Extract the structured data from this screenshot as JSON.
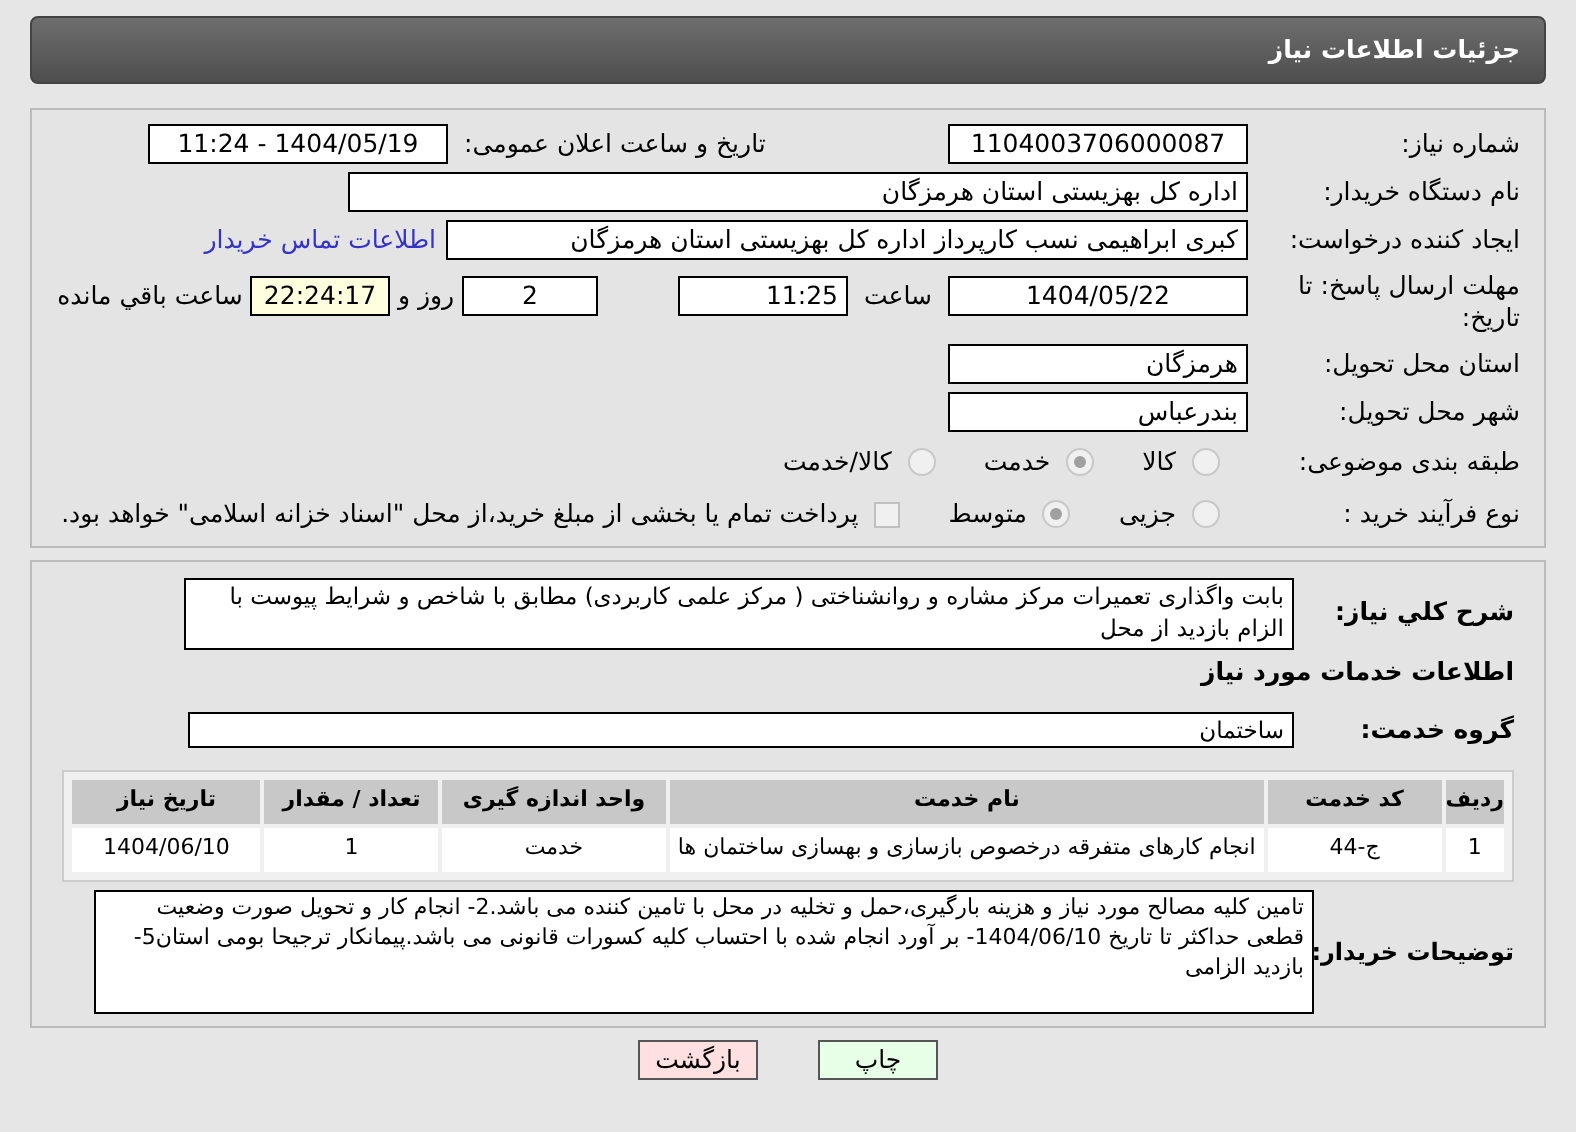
{
  "header": {
    "title": "جزئیات اطلاعات نیاز"
  },
  "fields": {
    "need_number": {
      "label": "شماره نیاز:",
      "value": "1104003706000087"
    },
    "announce": {
      "label": "تاریخ و ساعت اعلان عمومی:",
      "value": "1404/05/19 - 11:24"
    },
    "buyer": {
      "label": "نام دستگاه خریدار:",
      "value": "اداره کل بهزیستی استان هرمزگان"
    },
    "creator": {
      "label": "ایجاد کننده درخواست:",
      "value": "کبری  ابراهیمی نسب کارپرداز اداره کل بهزیستی استان هرمزگان",
      "link": "اطلاعات تماس خریدار"
    },
    "deadline": {
      "label": "مهلت ارسال پاسخ: تا تاریخ:",
      "date": "1404/05/22",
      "time_label": "ساعت",
      "time": "11:25",
      "days": "2",
      "days_label": "روز و",
      "remaining": "22:24:17",
      "remaining_label": "ساعت باقي مانده"
    },
    "province": {
      "label": "استان محل تحویل:",
      "value": "هرمزگان"
    },
    "city": {
      "label": "شهر محل تحویل:",
      "value": "بندرعباس"
    }
  },
  "category": {
    "label": "طبقه بندی موضوعی:",
    "disabled": true,
    "options": [
      {
        "label": "کالا",
        "selected": false
      },
      {
        "label": "خدمت",
        "selected": true
      },
      {
        "label": "کالا/خدمت",
        "selected": false
      }
    ]
  },
  "process": {
    "label": "نوع فرآیند خرید :",
    "disabled": true,
    "options": [
      {
        "label": "جزیی",
        "selected": false
      },
      {
        "label": "متوسط",
        "selected": true
      }
    ],
    "payment": {
      "checked": false,
      "label": "پرداخت تمام یا بخشی از مبلغ خرید،از محل \"اسناد خزانه اسلامی\" خواهد بود."
    }
  },
  "description": {
    "label": "شرح کلي نیاز:",
    "value": "بابت واگذاری تعمیرات مرکز مشاره و روانشناختی ( مرکز علمی کاربردی) مطابق با شاخص و شرایط پیوست با الزام بازدید از محل"
  },
  "services_heading": "اطلاعات خدمات مورد نیاز",
  "service_group": {
    "label": "گروه خدمت:",
    "value": "ساختمان"
  },
  "table": {
    "columns": [
      "ردیف",
      "کد خدمت",
      "نام خدمت",
      "واحد اندازه گیری",
      "تعداد / مقدار",
      "تاریخ نیاز"
    ],
    "rows": [
      [
        "1",
        "ج-44",
        "انجام کارهای متفرقه درخصوص بازسازی و بهسازی ساختمان ها",
        "خدمت",
        "1",
        "1404/06/10"
      ]
    ]
  },
  "notes": {
    "label": "توضیحات خریدار:",
    "value": "تامین کلیه مصالح مورد نیاز و هزینه بارگیری،حمل و تخلیه در محل با تامین کننده می باشد.2- انجام کار و تحویل صورت وضعیت قطعی حداکثر تا تاریخ 1404/06/10- بر آورد  انجام شده با احتساب کلیه کسورات قانونی می باشد.پیمانکار ترجیحا بومی استان5-بازدید الزامی"
  },
  "buttons": [
    {
      "label": "چاپ",
      "kind": "print"
    },
    {
      "label": "بازگشت",
      "kind": "back"
    }
  ]
}
